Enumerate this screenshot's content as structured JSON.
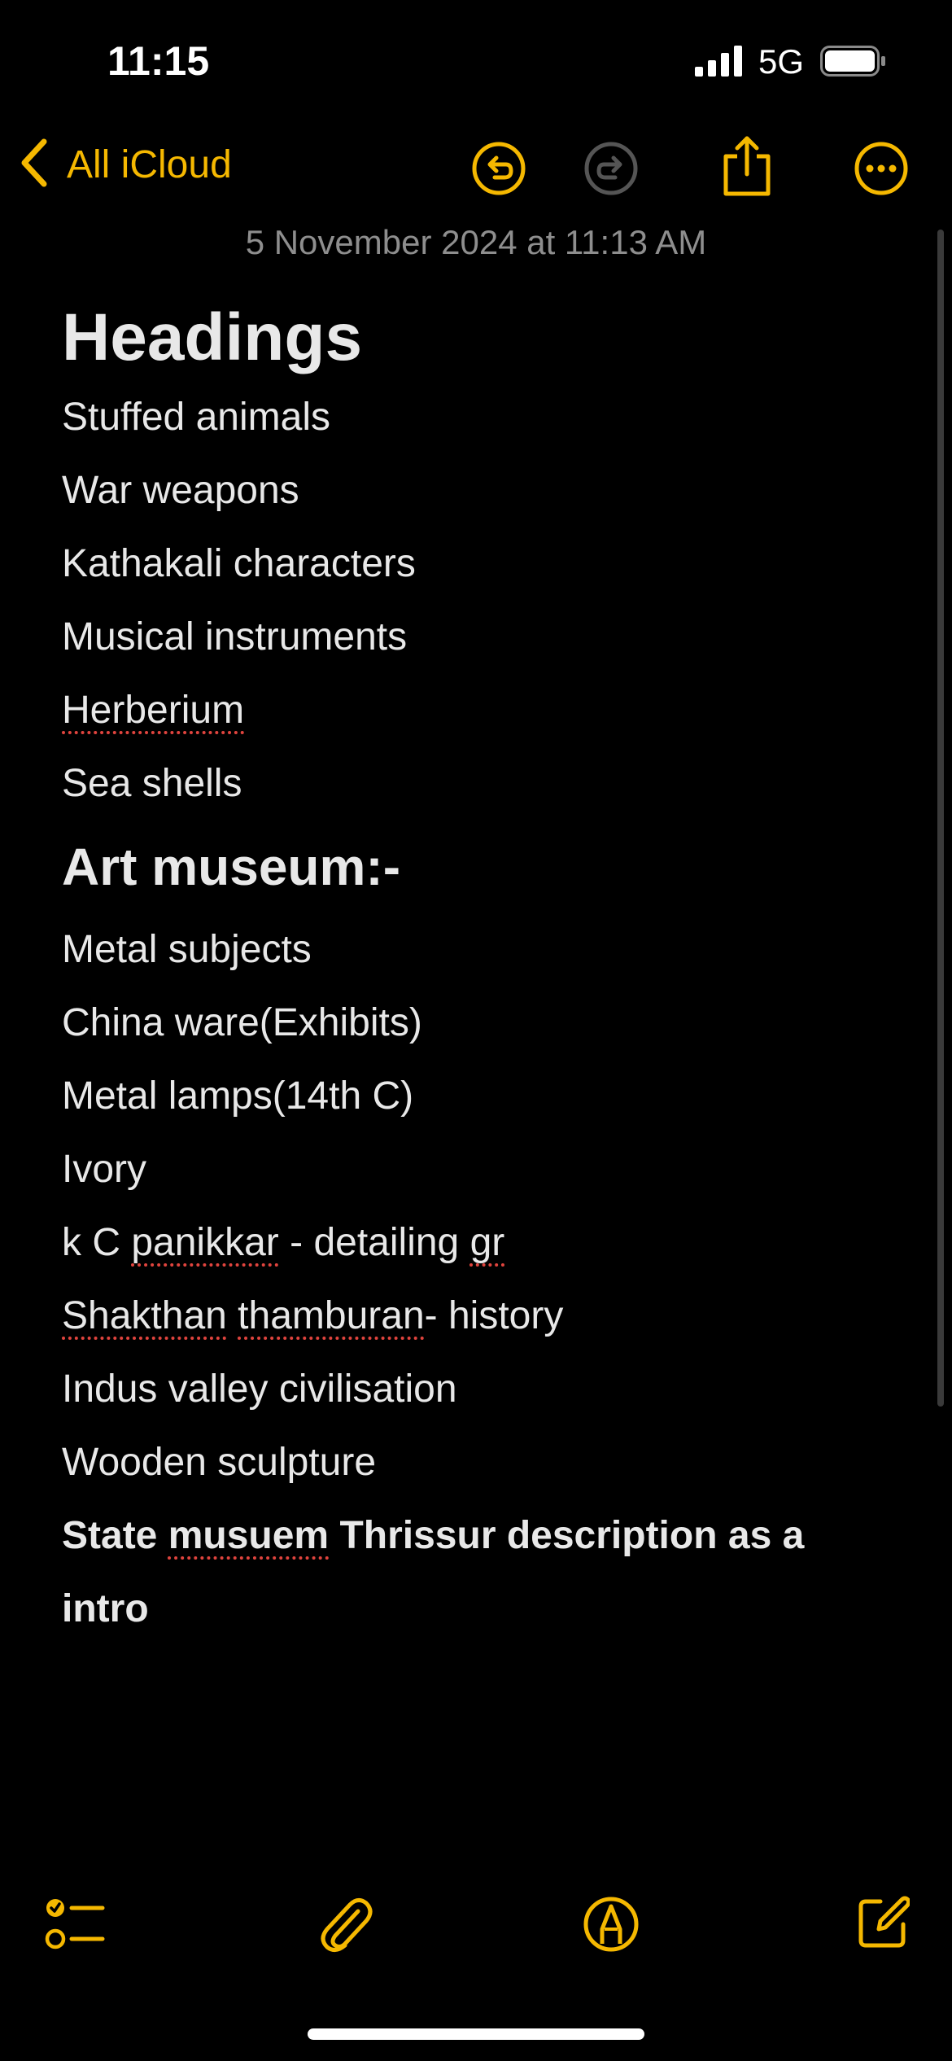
{
  "status_bar": {
    "time": "11:15",
    "network": "5G"
  },
  "nav": {
    "back_label": "All iCloud"
  },
  "note": {
    "date": "5 November 2024 at 11:13 AM",
    "title": "Headings",
    "headings_items": [
      "Stuffed animals",
      "War weapons",
      "Kathakali characters",
      "Musical instruments",
      "Herberium",
      "Sea shells"
    ],
    "section_heading": "Art museum:-",
    "art_items": {
      "i0": "Metal subjects",
      "i1": "China ware(Exhibits)",
      "i2": "Metal lamps(14th C)",
      "i3": "Ivory",
      "i4_a": "k C ",
      "i4_b": "panikkar",
      "i4_c": " - detailing ",
      "i4_d": "gr",
      "i5_a": "Shakthan",
      "i5_b": " ",
      "i5_c": "thamburan",
      "i5_d": "- history",
      "i6": "Indus valley civilisation",
      "i7": "Wooden sculpture"
    },
    "final_a": "State ",
    "final_b": "musuem",
    "final_c": " Thrissur description as a intro"
  },
  "colors": {
    "accent": "#f5b800",
    "background": "#000000",
    "text": "#e8e8e8",
    "secondary": "#8e8e8e",
    "spellcheck": "#e0443e"
  },
  "icons": [
    "chevron-left-icon",
    "undo-icon",
    "redo-icon",
    "share-icon",
    "more-icon",
    "checklist-icon",
    "paperclip-icon",
    "markup-icon",
    "compose-icon"
  ]
}
